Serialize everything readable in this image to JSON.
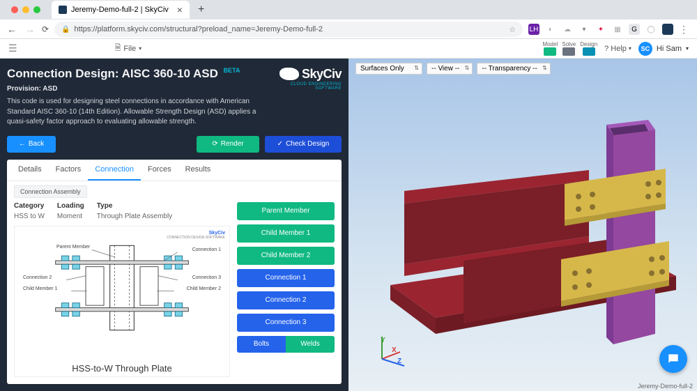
{
  "browser": {
    "tab_title": "Jeremy-Demo-full-2 | SkyCiv",
    "url": "https://platform.skyciv.com/structural?preload_name=Jeremy-Demo-full-2",
    "star_icon": "☆"
  },
  "app_bar": {
    "file_label": "File",
    "msd": {
      "model": "Model",
      "solve": "Solve",
      "design": "Design"
    },
    "help_label": "Help",
    "user_initials": "SC",
    "user_greeting": "Hi Sam"
  },
  "panel": {
    "title": "Connection Design: AISC 360-10 ASD",
    "beta_tag": "BETA",
    "provision_label": "Provision: ASD",
    "description": "This code is used for designing steel connections in accordance with American Standard AISC 360-10 (14th Edition). Allowable Strength Design (ASD) applies a quasi-safety factor approach to evaluating allowable strength.",
    "logo": {
      "brand": "SkyCiv",
      "sub": "CLOUD ENGINEERING SOFTWARE"
    },
    "buttons": {
      "back": "Back",
      "render": "Render",
      "check": "Check Design"
    }
  },
  "card": {
    "tabs": [
      "Details",
      "Factors",
      "Connection",
      "Forces",
      "Results"
    ],
    "active_tab": "Connection",
    "assembly_chip": "Connection Assembly",
    "columns": {
      "category_h": "Category",
      "category_v": "HSS to W",
      "loading_h": "Loading",
      "loading_v": "Moment",
      "type_h": "Type",
      "type_v": "Through Plate Assembly"
    },
    "diagram": {
      "brand": "SkyCiv",
      "brand_sub": "CONNECTION DESIGN SOFTWARE",
      "labels": {
        "parent": "Parent Member",
        "c1": "Connection 1",
        "c2": "Connection 2",
        "c3": "Connection 3",
        "cm1": "Child Member 1",
        "cm2": "Child Member 2"
      },
      "caption": "HSS-to-W Through Plate"
    },
    "buttons": {
      "parent": "Parent Member",
      "child1": "Child Member 1",
      "child2": "Child Member 2",
      "conn1": "Connection 1",
      "conn2": "Connection 2",
      "conn3": "Connection 3",
      "bolts": "Bolts",
      "welds": "Welds"
    }
  },
  "viewer": {
    "surfaces": "Surfaces Only",
    "view": "-- View --",
    "transparency": "-- Transparency --",
    "axes": {
      "x": "X",
      "y": "Y",
      "z": "Z"
    },
    "footer_name": "Jeremy-Demo-full-2"
  }
}
